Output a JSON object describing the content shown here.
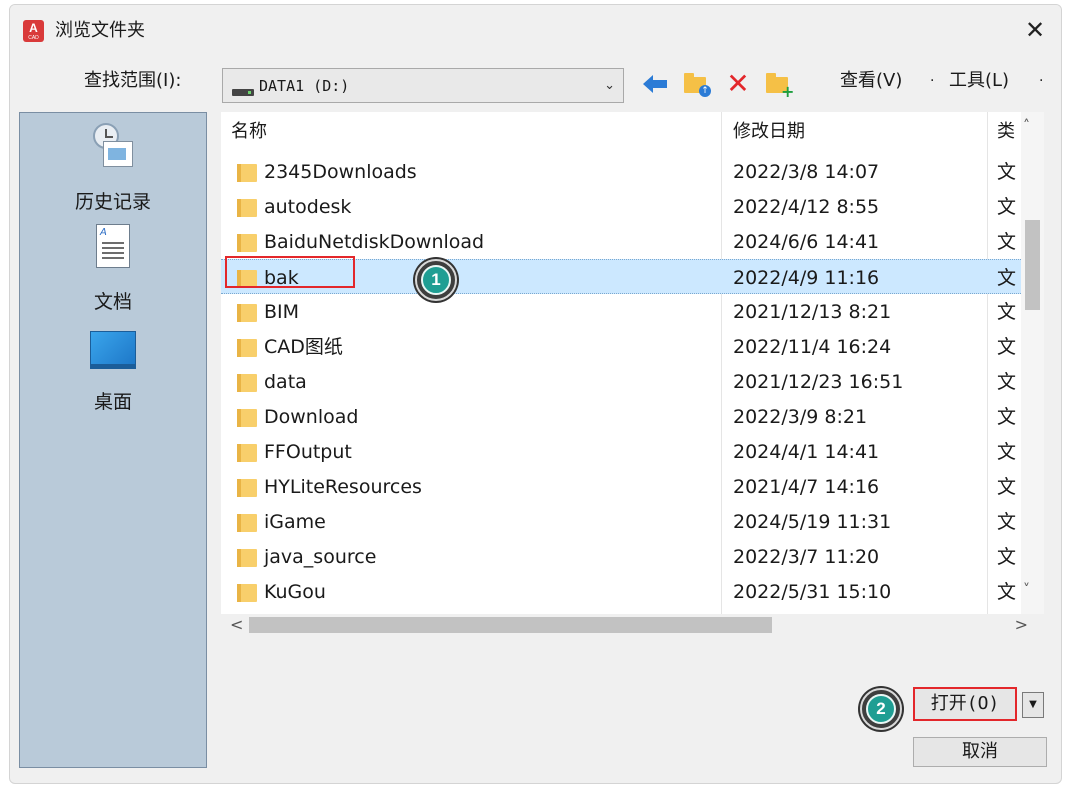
{
  "window": {
    "title": "浏览文件夹",
    "app_icon_letter": "A",
    "app_icon_sub": "CAD",
    "close_glyph": "✕"
  },
  "toolbar": {
    "lookin_label": "查找范围(I):",
    "lookin_value": "DATA1 (D:)",
    "back_glyph": "🡄",
    "delete_glyph": "✕",
    "view_menu": "查看(V)",
    "tools_menu": "工具(L)",
    "menu_dot": "·"
  },
  "places": [
    {
      "label": "历史记录",
      "icon": "history-icon"
    },
    {
      "label": "文档",
      "icon": "document-icon"
    },
    {
      "label": "桌面",
      "icon": "desktop-icon"
    }
  ],
  "columns": {
    "name": "名称",
    "date": "修改日期",
    "type": "类"
  },
  "files": [
    {
      "name": "2345Downloads",
      "date": "2022/3/8 14:07",
      "type": "文"
    },
    {
      "name": "autodesk",
      "date": "2022/4/12 8:55",
      "type": "文"
    },
    {
      "name": "BaiduNetdiskDownload",
      "date": "2024/6/6 14:41",
      "type": "文"
    },
    {
      "name": "bak",
      "date": "2022/4/9 11:16",
      "type": "文",
      "selected": true
    },
    {
      "name": "BIM",
      "date": "2021/12/13 8:21",
      "type": "文"
    },
    {
      "name": "CAD图纸",
      "date": "2022/11/4 16:24",
      "type": "文"
    },
    {
      "name": "data",
      "date": "2021/12/23 16:51",
      "type": "文"
    },
    {
      "name": "Download",
      "date": "2022/3/9 8:21",
      "type": "文"
    },
    {
      "name": "FFOutput",
      "date": "2024/4/1 14:41",
      "type": "文"
    },
    {
      "name": "HYLiteResources",
      "date": "2021/4/7 14:16",
      "type": "文"
    },
    {
      "name": "iGame",
      "date": "2024/5/19 11:31",
      "type": "文"
    },
    {
      "name": "java_source",
      "date": "2022/3/7 11:20",
      "type": "文"
    },
    {
      "name": "KuGou",
      "date": "2022/5/31 15:10",
      "type": "文"
    }
  ],
  "buttons": {
    "open": "打开(O)",
    "open_dropdown_glyph": "▼",
    "cancel": "取消"
  },
  "scroll": {
    "up_glyph": "˄",
    "down_glyph": "˅",
    "left_glyph": "<",
    "right_glyph": ">"
  },
  "annotations": {
    "step1": "1",
    "step2": "2"
  },
  "colors": {
    "highlight": "#e3272b",
    "selection": "#cce8ff",
    "places_bg": "#b9cad9",
    "badge": "#1f9e93"
  }
}
